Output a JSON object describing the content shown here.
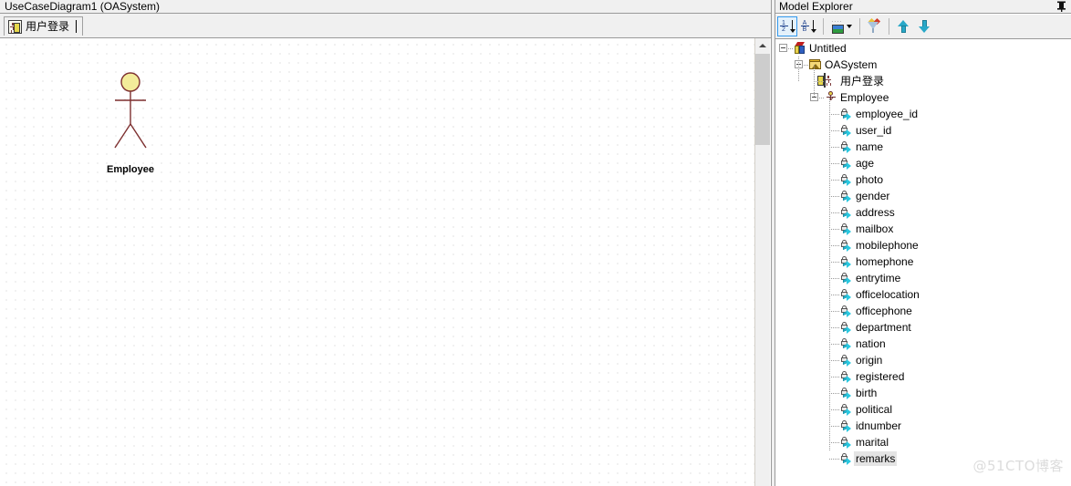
{
  "editor": {
    "title": "UseCaseDiagram1 (OASystem)",
    "tab": {
      "label": "用户登录",
      "icon": "usecase-icon"
    },
    "diagram": {
      "actor": {
        "name": "Employee",
        "head_color": "#f3ec9a",
        "line_color": "#7d2f2f"
      },
      "grid_dot_color": "#c8c8c8",
      "background": "#ffffff"
    },
    "scrollbar": {
      "up_arrow": "▲"
    }
  },
  "explorer": {
    "title": "Model Explorer",
    "pin_label": "⇶",
    "toolbar": [
      {
        "name": "sort-by-order-button",
        "icon": "sort-numeric-icon",
        "active": true
      },
      {
        "name": "sort-alphabetically-button",
        "icon": "sort-alpha-icon",
        "active": false
      },
      {
        "name": "view-options-button",
        "icon": "picture-icon",
        "active": false,
        "has_caret": true
      },
      {
        "name": "filter-button",
        "icon": "funnel-icon",
        "active": false
      },
      {
        "name": "move-up-button",
        "icon": "arrow-up-icon",
        "active": false
      },
      {
        "name": "move-down-button",
        "icon": "arrow-down-icon",
        "active": false
      }
    ],
    "tree": {
      "root": {
        "label": "Untitled",
        "icon": "cube-icon",
        "expanded": true
      },
      "package": {
        "label": "OASystem",
        "icon": "package-icon",
        "expanded": true
      },
      "usecase": {
        "label": "用户登录",
        "icon": "usecase-icon"
      },
      "actor": {
        "label": "Employee",
        "icon": "actor-icon",
        "expanded": true
      },
      "attributes": [
        "employee_id",
        "user_id",
        "name",
        "age",
        "photo",
        "gender",
        "address",
        "mailbox",
        "mobilephone",
        "homephone",
        "entrytime",
        "officelocation",
        "officephone",
        "department",
        "nation",
        "origin",
        "registered",
        "birth",
        "political",
        "idnumber",
        "marital",
        "remarks"
      ],
      "selected_attribute": "remarks",
      "attribute_icon": "private-attribute-icon"
    }
  },
  "watermark": {
    "text": "@51CTO博客"
  }
}
